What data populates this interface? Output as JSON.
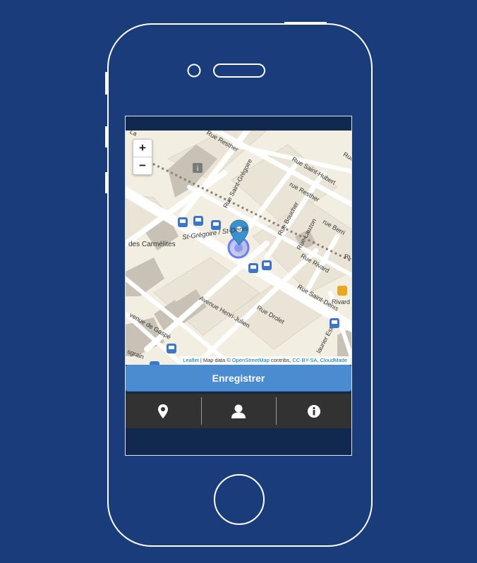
{
  "device": {
    "frame_color": "#ffffff",
    "background": "#1a3c7a"
  },
  "map": {
    "streets": [
      {
        "id": "rue-resther-top",
        "text": "Rue Resther"
      },
      {
        "id": "rue-saint-hubert",
        "text": "Rue Saint-Hubert"
      },
      {
        "id": "rue-resther",
        "text": "rue Resther"
      },
      {
        "id": "rue-saint-gregoire",
        "text": "Rue Saint-Grégoire"
      },
      {
        "id": "rue-boucher",
        "text": "Rue Boucher"
      },
      {
        "id": "rue-berri",
        "text": "rue Berri"
      },
      {
        "id": "rue-lauzon",
        "text": "Rue Lauzon"
      },
      {
        "id": "rue-rivard",
        "text": "Rue Rivard"
      },
      {
        "id": "rue-saint-denis",
        "text": "Rue Saint-Denis"
      },
      {
        "id": "des-carmelites",
        "text": "des Carmélites"
      },
      {
        "id": "st-gregoire-st-denis",
        "text": "St-Grégoire / St-Denis"
      },
      {
        "id": "avenue-henri-julien",
        "text": "Avenue Henri-Julien"
      },
      {
        "id": "rue-drolet",
        "text": "Rue Drolet"
      },
      {
        "id": "avenue-de-gaspe",
        "text": "venue de Gaspé"
      },
      {
        "id": "rivard-right",
        "text": "Rivard"
      },
      {
        "id": "laurier-est",
        "text": "laurier Est"
      },
      {
        "id": "sgrain",
        "text": "sgrain"
      },
      {
        "id": "rue-top-left",
        "text": "Rue"
      },
      {
        "id": "rue-top-right",
        "text": "Rue"
      },
      {
        "id": "la-right",
        "text": "La"
      }
    ],
    "zoom_in_label": "+",
    "zoom_out_label": "−",
    "attribution": {
      "leaflet": "Leaflet",
      "sep": " | Map data © ",
      "osm": "OpenStreetMap",
      "contribs": " contribs, ",
      "ccbysa": "CC-BY-SA",
      "sep2": ", ",
      "cloudmade": "CloudMade"
    }
  },
  "actions": {
    "save_label": "Enregistrer"
  },
  "tabs": [
    {
      "name": "location",
      "icon": "map-marker-icon"
    },
    {
      "name": "profile",
      "icon": "user-icon"
    },
    {
      "name": "info",
      "icon": "info-icon"
    }
  ],
  "colors": {
    "primary_button": "#4a8ccf",
    "tabbar": "#323232",
    "map_background": "#f3eee2",
    "marker": "#3a91d0",
    "bus_stop": "#3d76c8"
  }
}
